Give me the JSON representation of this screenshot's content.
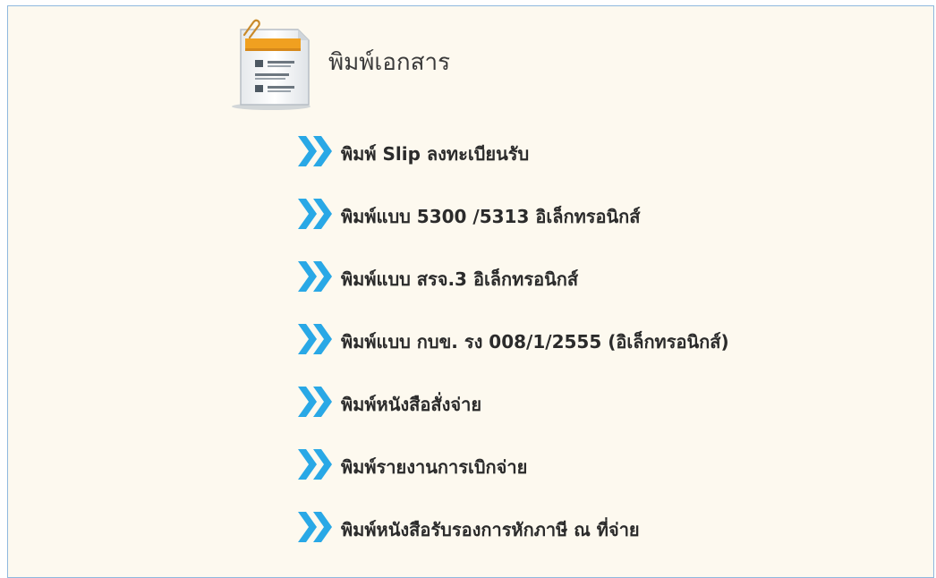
{
  "section": {
    "title": "พิมพ์เอกสาร",
    "icon": "document-form-icon"
  },
  "colors": {
    "panel_background": "#fdf9ef",
    "panel_border": "#8fb8de",
    "chevron": "#29a8e6",
    "icon_header_bar": "#f0a020"
  },
  "menu": {
    "bullet_icon": "double-chevron-right-icon",
    "items": [
      {
        "label": "พิมพ์ Slip ลงทะเบียนรับ"
      },
      {
        "label": "พิมพ์แบบ 5300 /5313 อิเล็กทรอนิกส์"
      },
      {
        "label": "พิมพ์แบบ สรจ.3 อิเล็กทรอนิกส์"
      },
      {
        "label": "พิมพ์แบบ กบข. รง 008/1/2555 (อิเล็กทรอนิกส์)"
      },
      {
        "label": "พิมพ์หนังสือสั่งจ่าย"
      },
      {
        "label": "พิมพ์รายงานการเบิกจ่าย"
      },
      {
        "label": "พิมพ์หนังสือรับรองการหักภาษี ณ ที่จ่าย"
      }
    ]
  }
}
